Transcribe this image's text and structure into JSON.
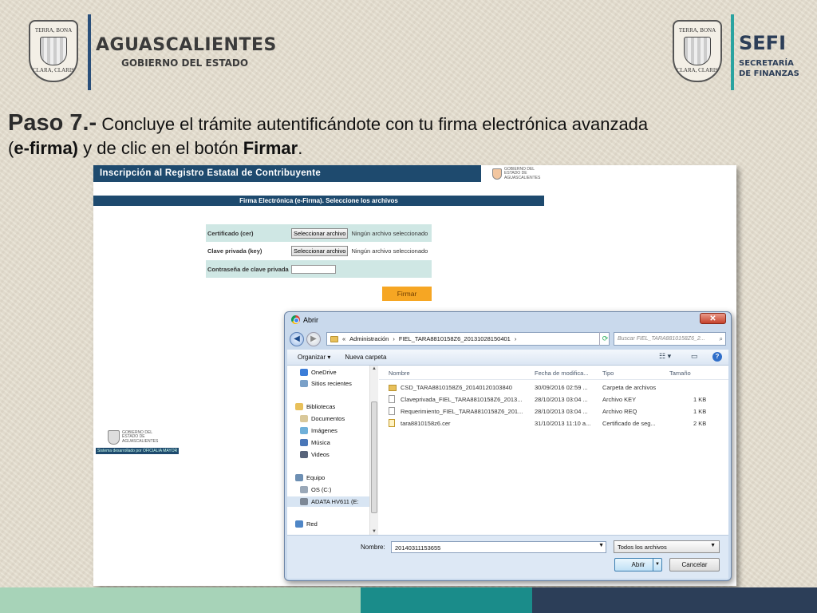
{
  "header": {
    "state_name": "AGUASCALIENTES",
    "state_sub": "GOBIERNO DEL ESTADO",
    "seal_top": "TERRA, BONA",
    "seal_bottom": "CLARA, CLARIS",
    "agency_short": "SEFI",
    "agency_line1": "SECRETARÍA",
    "agency_line2": "DE FINANZAS"
  },
  "instruction": {
    "step": "Paso 7.-",
    "text1": " Concluye el trámite autentificándote con tu firma electrónica avanzada",
    "open_paren": "(",
    "efirma": "e-firma)",
    "text2": " y de clic en el botón ",
    "button_word": "Firmar",
    "period": "."
  },
  "app": {
    "banner": "Inscripción al Registro Estatal de Contribuyente",
    "logo_lines": [
      "GOBIERNO DEL",
      "ESTADO DE",
      "AGUASCALIENTES"
    ],
    "section_title": "Firma Electrónica (e-Firma). Seleccione los archivos",
    "cert_label": "Certificado (cer)",
    "key_label": "Clave privada (key)",
    "select_file": "Seleccionar archivo",
    "no_file": "Ningún archivo seleccionado",
    "password_label": "Contraseña de clave privada",
    "sign_button": "Firmar",
    "dev_note": "Sistema desarrollado por OFICIALIA MAYOR"
  },
  "dialog": {
    "title": "Abrir",
    "address": [
      "«",
      "Administración",
      "›",
      "FIEL_TARA8810158Z6_20131028150401",
      "›"
    ],
    "search_placeholder": "Buscar FIEL_TARA8810158Z6_2...",
    "organize": "Organizar ▾",
    "new_folder": "Nueva carpeta",
    "nav": [
      "OneDrive",
      "Sitios recientes",
      "Bibliotecas",
      "Documentos",
      "Imágenes",
      "Música",
      "Videos",
      "Equipo",
      "OS (C:)",
      "ADATA HV611 (E:",
      "Red"
    ],
    "columns": [
      "Nombre",
      "Fecha de modifica...",
      "Tipo",
      "Tamaño"
    ],
    "files": [
      {
        "name": "CSD_TARA8810158Z6_20140120103840",
        "date": "30/09/2016 02:59 ...",
        "type": "Carpeta de archivos",
        "size": ""
      },
      {
        "name": "Claveprivada_FIEL_TARA8810158Z6_2013...",
        "date": "28/10/2013 03:04 ...",
        "type": "Archivo KEY",
        "size": "1 KB"
      },
      {
        "name": "Requerimiento_FIEL_TARA8810158Z6_201...",
        "date": "28/10/2013 03:04 ...",
        "type": "Archivo REQ",
        "size": "1 KB"
      },
      {
        "name": "tara8810158z6.cer",
        "date": "31/10/2013 11:10 a...",
        "type": "Certificado de seg...",
        "size": "2 KB"
      }
    ],
    "name_label": "Nombre:",
    "name_value": "20140311153655",
    "filter": "Todos los archivos",
    "open_button": "Abrir",
    "cancel_button": "Cancelar"
  },
  "colors": {
    "banner": "#1e4a6e",
    "sign_button": "#f6a623",
    "footer": [
      "#a7d3b8",
      "#1a8c8a",
      "#2c3e58"
    ]
  }
}
